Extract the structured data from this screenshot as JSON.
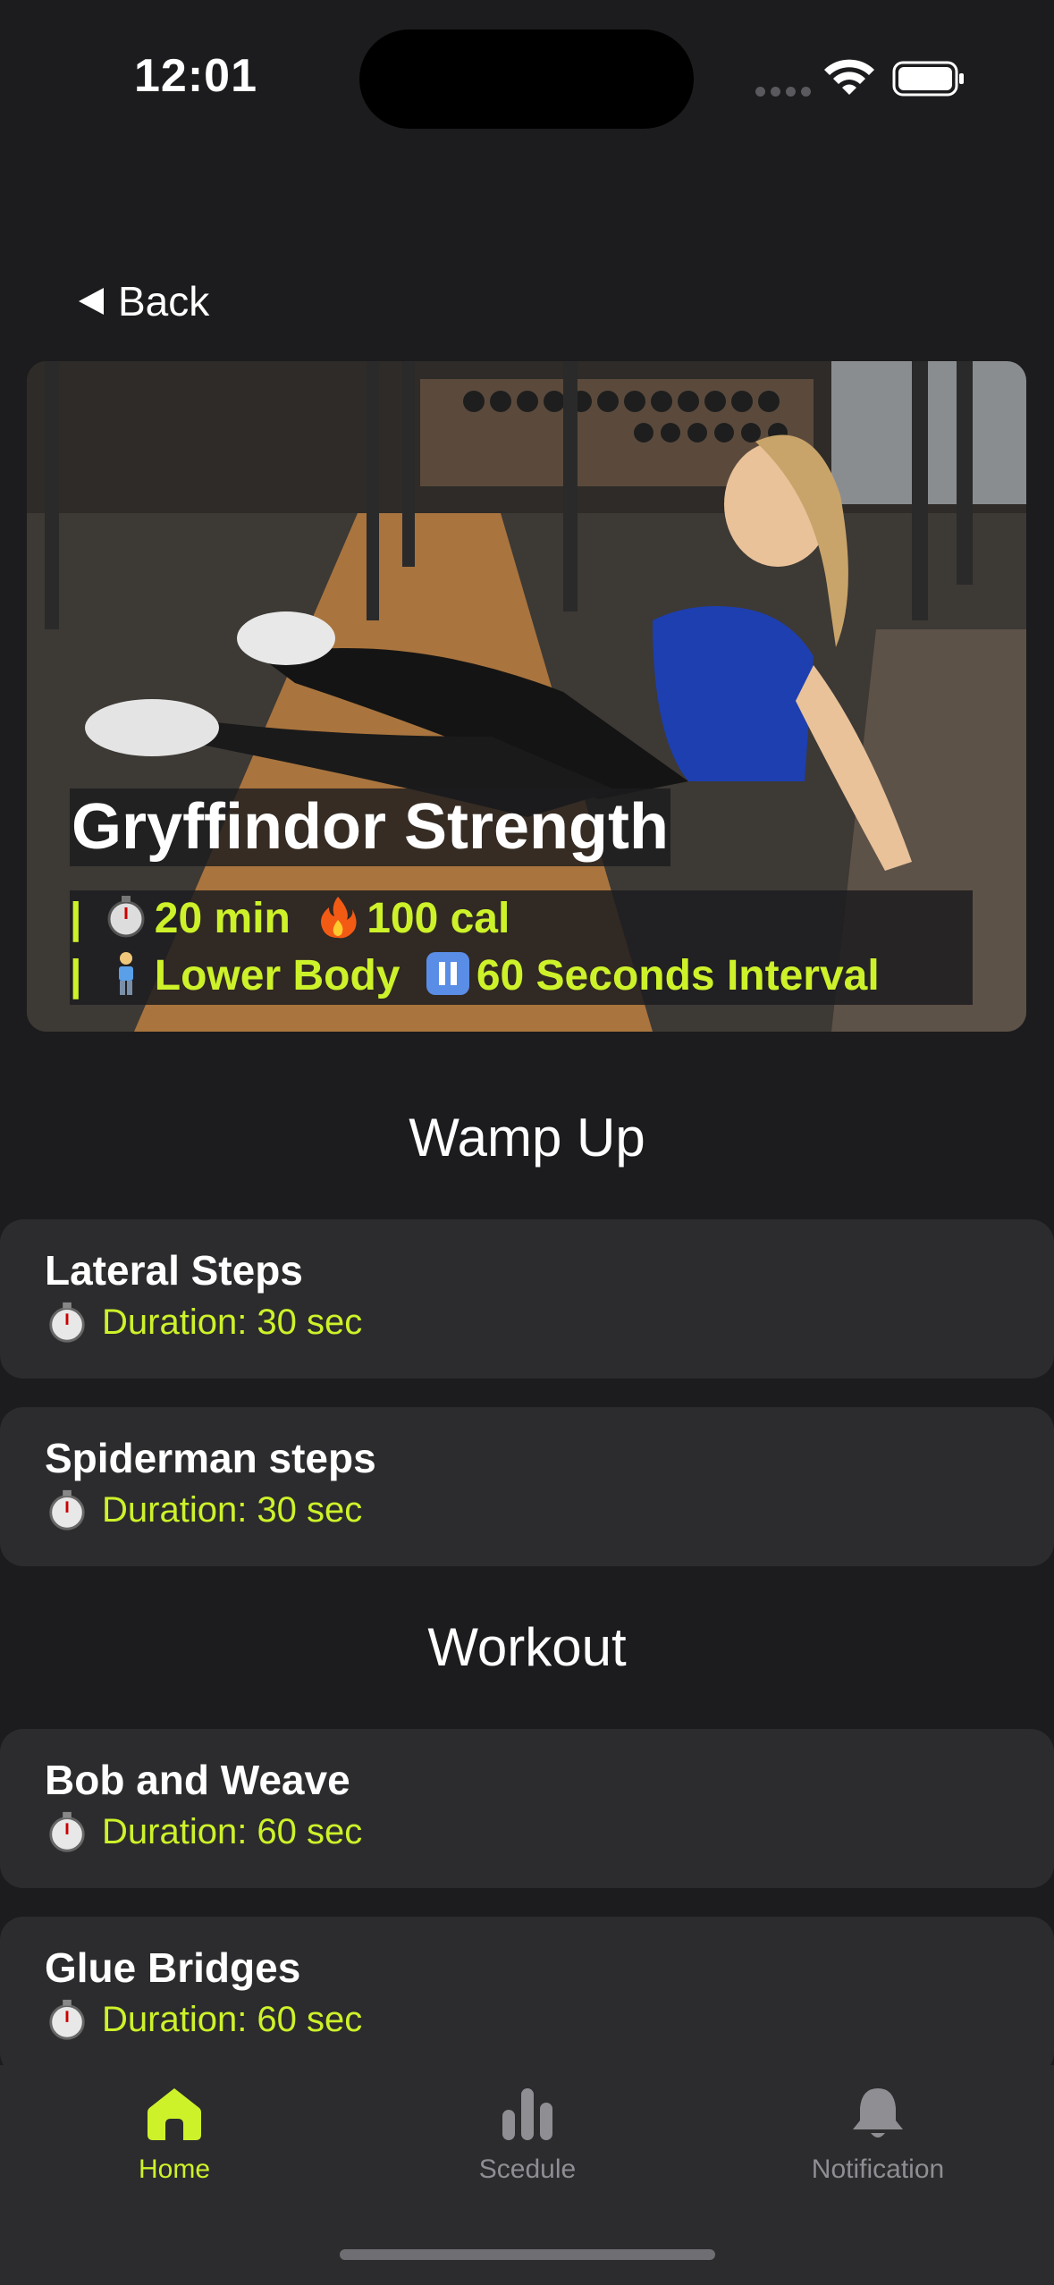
{
  "status_bar": {
    "time": "12:01"
  },
  "nav": {
    "back_label": "Back"
  },
  "hero": {
    "title": "Gryffindor Strength",
    "duration": "20 min",
    "calories": "100 cal",
    "body_part": "Lower Body",
    "interval": "60 Seconds Interval",
    "icons": [
      "stopwatch-icon",
      "fire-icon",
      "person-icon",
      "pause-icon"
    ]
  },
  "sections": [
    {
      "title": "Wamp Up",
      "exercises": [
        {
          "name": "Lateral Steps",
          "duration": "Duration: 30 sec"
        },
        {
          "name": "Spiderman steps",
          "duration": "Duration: 30 sec"
        }
      ]
    },
    {
      "title": "Workout",
      "exercises": [
        {
          "name": "Bob and Weave",
          "duration": "Duration: 60 sec"
        },
        {
          "name": "Glue Bridges",
          "duration": "Duration: 60 sec"
        }
      ]
    }
  ],
  "tab_bar": {
    "tabs": [
      {
        "label": "Home",
        "icon": "home-icon",
        "active": true
      },
      {
        "label": "Scedule",
        "icon": "bar-chart-icon",
        "active": false
      },
      {
        "label": "Notification",
        "icon": "bell-icon",
        "active": false
      }
    ]
  },
  "colors": {
    "accent": "#cdf22a",
    "background": "#1c1c1e",
    "card": "#2c2c2e",
    "inactive": "#8e8e93"
  }
}
